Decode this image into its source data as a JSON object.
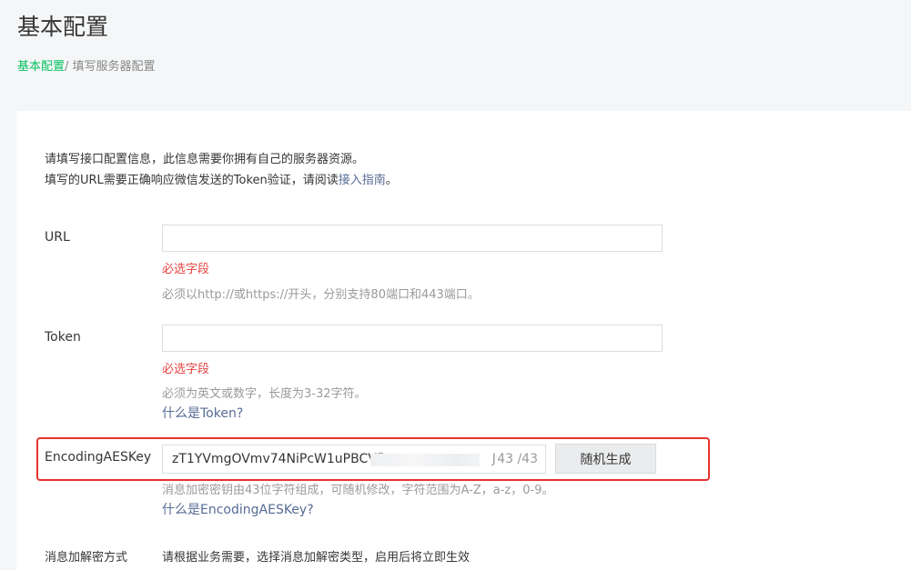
{
  "header": {
    "title": "基本配置",
    "breadcrumb": {
      "link": "基本配置",
      "separator": "/ ",
      "current": "填写服务器配置"
    }
  },
  "intro": {
    "line1": "请填写接口配置信息，此信息需要你拥有自己的服务器资源。",
    "line2_prefix": "填写的URL需要正确响应微信发送的Token验证，请阅读",
    "line2_link": "接入指南",
    "line2_suffix": "。"
  },
  "url": {
    "label": "URL",
    "value": "",
    "error": "必选字段",
    "hint": "必须以http://或https://开头，分别支持80端口和443端口。"
  },
  "token": {
    "label": "Token",
    "value": "",
    "error": "必选字段",
    "hint": "必须为英文或数字，长度为3-32字符。",
    "help_link": "什么是Token?"
  },
  "aes": {
    "label": "EncodingAESKey",
    "value": "zT1YVmgOVmv74NiPcW1uPBCV5",
    "value_tail": "J9",
    "counter": "43 /43",
    "generate_button": "随机生成",
    "hint": "消息加密密钥由43位字符组成，可随机修改，字符范围为A-Z，a-z，0-9。",
    "help_link": "什么是EncodingAESKey?"
  },
  "encryption_mode": {
    "label": "消息加解密方式",
    "description": "请根据业务需要，选择消息加解密类型，启用后将立即生效"
  },
  "colors": {
    "accent_green": "#07c160",
    "link_blue": "#576b95",
    "error_red": "#e64340",
    "highlight_red": "#e8322e"
  }
}
